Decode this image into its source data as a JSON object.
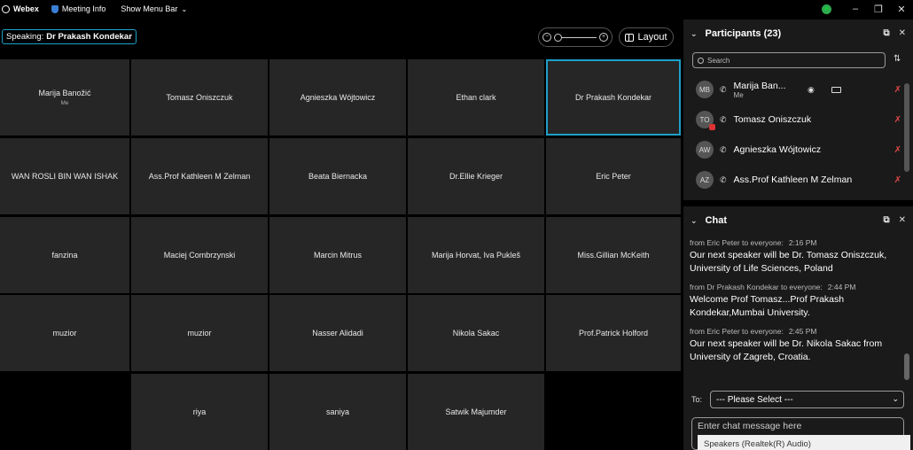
{
  "titlebar": {
    "app_name": "Webex",
    "meeting_info": "Meeting Info",
    "show_menu_bar": "Show Menu Bar"
  },
  "toolbar": {
    "speaking_label": "Speaking:",
    "speaking_name": "Dr Prakash Kondekar",
    "layout_label": "Layout"
  },
  "grid": {
    "tiles": [
      {
        "name": "Marija Banožić",
        "sub": "Me"
      },
      {
        "name": "Tomasz Oniszczuk"
      },
      {
        "name": "Agnieszka Wójtowicz"
      },
      {
        "name": "Ethan clark"
      },
      {
        "name": "Dr Prakash Kondekar",
        "active": true
      },
      {
        "name": "WAN ROSLI BIN WAN ISHAK"
      },
      {
        "name": "Ass.Prof Kathleen M Zelman"
      },
      {
        "name": "Beata Biernacka"
      },
      {
        "name": "Dr.Ellie Krieger"
      },
      {
        "name": "Eric Peter"
      },
      {
        "name": "fanzina"
      },
      {
        "name": "Maciej Combrzynski"
      },
      {
        "name": "Marcin Mitrus"
      },
      {
        "name": "Marija Horvat, Iva Pukleš"
      },
      {
        "name": "Miss.Gillian McKeith"
      },
      {
        "name": "muzior"
      },
      {
        "name": "muzior"
      },
      {
        "name": "Nasser Alidadi"
      },
      {
        "name": "Nikola Sakac"
      },
      {
        "name": "Prof.Patrick Holford"
      },
      {
        "name": "riya"
      },
      {
        "name": "saniya"
      },
      {
        "name": "Satwik Majumder"
      }
    ]
  },
  "participants": {
    "title": "Participants (23)",
    "search_placeholder": "Search",
    "list": [
      {
        "initials": "MB",
        "name": "Marija Ban...",
        "sub": "Me"
      },
      {
        "initials": "TO",
        "name": "Tomasz Oniszczuk"
      },
      {
        "initials": "AW",
        "name": "Agnieszka Wójtowicz"
      },
      {
        "initials": "AZ",
        "name": "Ass.Prof Kathleen M Zelman"
      }
    ]
  },
  "chat": {
    "title": "Chat",
    "messages": [
      {
        "meta": "from Eric Peter to everyone:",
        "time": "2:16 PM",
        "text": "Our next speaker will be Dr. Tomasz Oniszczuk, University of Life Sciences, Poland"
      },
      {
        "meta": "from Dr Prakash Kondekar to everyone:",
        "time": "2:44 PM",
        "text": "Welcome Prof Tomasz...Prof Prakash Kondekar,Mumbai University."
      },
      {
        "meta": "from Eric Peter to everyone:",
        "time": "2:45 PM",
        "text": "Our next speaker will be Dr. Nikola Sakac from University of Zagreb, Croatia."
      }
    ],
    "to_label": "To:",
    "to_value": "--- Please Select ---",
    "input_placeholder": "Enter chat message here"
  },
  "tooltip": {
    "text": "Speakers (Realtek(R) Audio)"
  },
  "colors": {
    "accent": "#1ea0c8",
    "tile_bg": "#262626",
    "panel_bg": "#1a1a1a",
    "mute": "#e04848"
  }
}
